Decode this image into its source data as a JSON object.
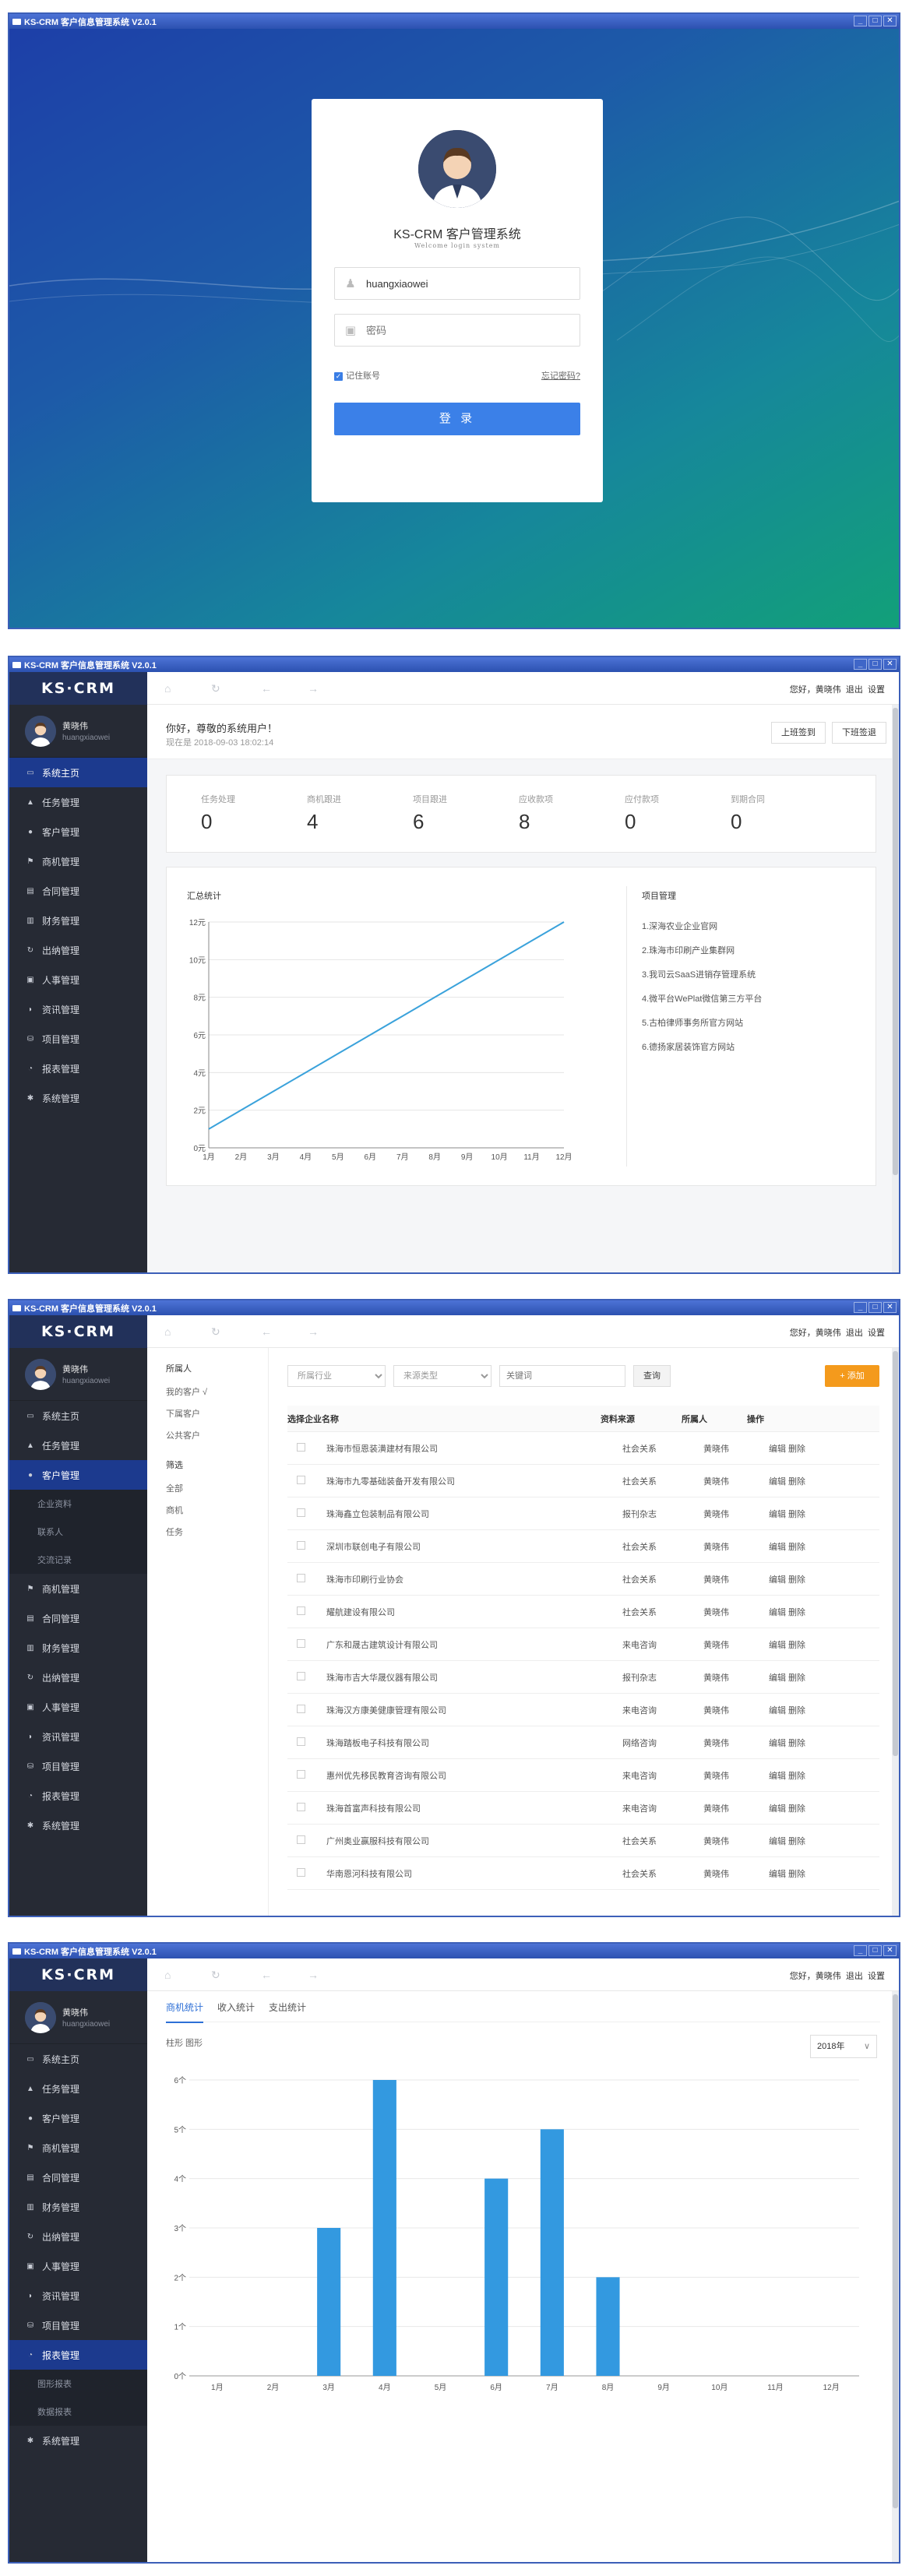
{
  "app_title": "KS-CRM 客户信息管理系统 V2.0.1",
  "window_buttons": [
    "_",
    "□",
    "✕"
  ],
  "login": {
    "title": "KS-CRM 客户管理系统",
    "subtitle": "Welcome login system",
    "username_value": "huangxiaowei",
    "password_placeholder": "密码",
    "remember_label": "记住账号",
    "forgot_label": "忘记密码?",
    "login_button": "登 录"
  },
  "logo": "KS·CRM",
  "user": {
    "name": "黄晓伟",
    "username": "huangxiaowei"
  },
  "topbar": {
    "greeting": "您好，黄晓伟",
    "logout": "退出",
    "settings": "设置"
  },
  "menu": [
    {
      "label": "系统主页",
      "icon": "monitor-icon"
    },
    {
      "label": "任务管理",
      "icon": "bell-icon"
    },
    {
      "label": "客户管理",
      "icon": "user-circle-icon"
    },
    {
      "label": "商机管理",
      "icon": "flag-icon"
    },
    {
      "label": "合同管理",
      "icon": "file-icon"
    },
    {
      "label": "财务管理",
      "icon": "bar-chart-icon"
    },
    {
      "label": "出纳管理",
      "icon": "refresh-icon"
    },
    {
      "label": "人事管理",
      "icon": "id-card-icon"
    },
    {
      "label": "资讯管理",
      "icon": "rss-icon"
    },
    {
      "label": "项目管理",
      "icon": "database-icon"
    },
    {
      "label": "报表管理",
      "icon": "pie-icon"
    },
    {
      "label": "系统管理",
      "icon": "gear-icon"
    }
  ],
  "customer_submenu": [
    "企业资料",
    "联系人",
    "交流记录"
  ],
  "report_submenu": [
    "图形报表",
    "数据报表"
  ],
  "dashboard": {
    "welcome": "你好，尊敬的系统用户！",
    "time": "现在是 2018-09-03 18:02:14",
    "checkin": "上班签到",
    "checkout": "下班签退",
    "stats": [
      {
        "label": "任务处理",
        "value": "0"
      },
      {
        "label": "商机跟进",
        "value": "4"
      },
      {
        "label": "项目跟进",
        "value": "6"
      },
      {
        "label": "应收款项",
        "value": "8"
      },
      {
        "label": "应付款项",
        "value": "0"
      },
      {
        "label": "到期合同",
        "value": "0"
      }
    ],
    "chart_title": "汇总统计",
    "project_title": "项目管理",
    "projects": [
      "1.深海农业企业官网",
      "2.珠海市印刷产业集群网",
      "3.我司云SaaS进销存管理系统",
      "4.微平台WePlat微信第三方平台",
      "5.古柏律师事务所官方网站",
      "6.德扬家居装饰官方网站"
    ]
  },
  "customers": {
    "side_heading1": "所属人",
    "side_items1": [
      "我的客户 √",
      "下属客户",
      "公共客户"
    ],
    "side_heading2": "筛选",
    "side_items2": [
      "全部",
      "商机",
      "任务"
    ],
    "filter_industry": "所属行业",
    "filter_source": "来源类型",
    "keyword_placeholder": "关键词",
    "search_button": "查询",
    "add_button": "+ 添加",
    "columns": [
      "选择",
      "企业名称",
      "资料来源",
      "所属人",
      "操作"
    ],
    "rows": [
      [
        "珠海市恒恩装潢建材有限公司",
        "社会关系",
        "黄晓伟",
        "编辑 删除"
      ],
      [
        "珠海市九零基础装备开发有限公司",
        "社会关系",
        "黄晓伟",
        "编辑 删除"
      ],
      [
        "珠海鑫立包装制品有限公司",
        "报刊杂志",
        "黄晓伟",
        "编辑 删除"
      ],
      [
        "深圳市联创电子有限公司",
        "社会关系",
        "黄晓伟",
        "编辑 删除"
      ],
      [
        "珠海市印刷行业协会",
        "社会关系",
        "黄晓伟",
        "编辑 删除"
      ],
      [
        "耀航建设有限公司",
        "社会关系",
        "黄晓伟",
        "编辑 删除"
      ],
      [
        "广东和晟古建筑设计有限公司",
        "来电咨询",
        "黄晓伟",
        "编辑 删除"
      ],
      [
        "珠海市吉大华晟仪器有限公司",
        "报刊杂志",
        "黄晓伟",
        "编辑 删除"
      ],
      [
        "珠海汉方康美健康管理有限公司",
        "来电咨询",
        "黄晓伟",
        "编辑 删除"
      ],
      [
        "珠海踏板电子科技有限公司",
        "网络咨询",
        "黄晓伟",
        "编辑 删除"
      ],
      [
        "惠州优先移民教育咨询有限公司",
        "来电咨询",
        "黄晓伟",
        "编辑 删除"
      ],
      [
        "珠海首富声科技有限公司",
        "来电咨询",
        "黄晓伟",
        "编辑 删除"
      ],
      [
        "广州奥业赢服科技有限公司",
        "社会关系",
        "黄晓伟",
        "编辑 删除"
      ],
      [
        "华南恩河科技有限公司",
        "社会关系",
        "黄晓伟",
        "编辑 删除"
      ]
    ]
  },
  "reports": {
    "tabs": [
      "商机统计",
      "收入统计",
      "支出统计"
    ],
    "view_label": "柱形 图形",
    "year": "2018年"
  },
  "chart_data": [
    {
      "type": "line",
      "title": "汇总统计",
      "x": [
        "1月",
        "2月",
        "3月",
        "4月",
        "5月",
        "6月",
        "7月",
        "8月",
        "9月",
        "10月",
        "11月",
        "12月"
      ],
      "y_tick_labels": [
        "0元",
        "2元",
        "4元",
        "6元",
        "8元",
        "10元",
        "12元"
      ],
      "ylim": [
        0,
        12
      ],
      "series": [
        {
          "values": [
            1,
            2,
            3,
            4,
            5,
            6,
            7,
            8,
            9,
            10,
            11,
            12
          ]
        }
      ],
      "color": "#3aa2db",
      "grid": true
    },
    {
      "type": "bar",
      "categories": [
        "1月",
        "2月",
        "3月",
        "4月",
        "5月",
        "6月",
        "7月",
        "8月",
        "9月",
        "10月",
        "11月",
        "12月"
      ],
      "values": [
        0,
        0,
        3,
        6,
        0,
        4,
        5,
        2,
        0,
        0,
        0,
        0
      ],
      "y_tick_labels": [
        "0个",
        "1个",
        "2个",
        "3个",
        "4个",
        "5个",
        "6个"
      ],
      "ylim": [
        0,
        6
      ],
      "color": "#3399e0",
      "grid": true
    }
  ]
}
